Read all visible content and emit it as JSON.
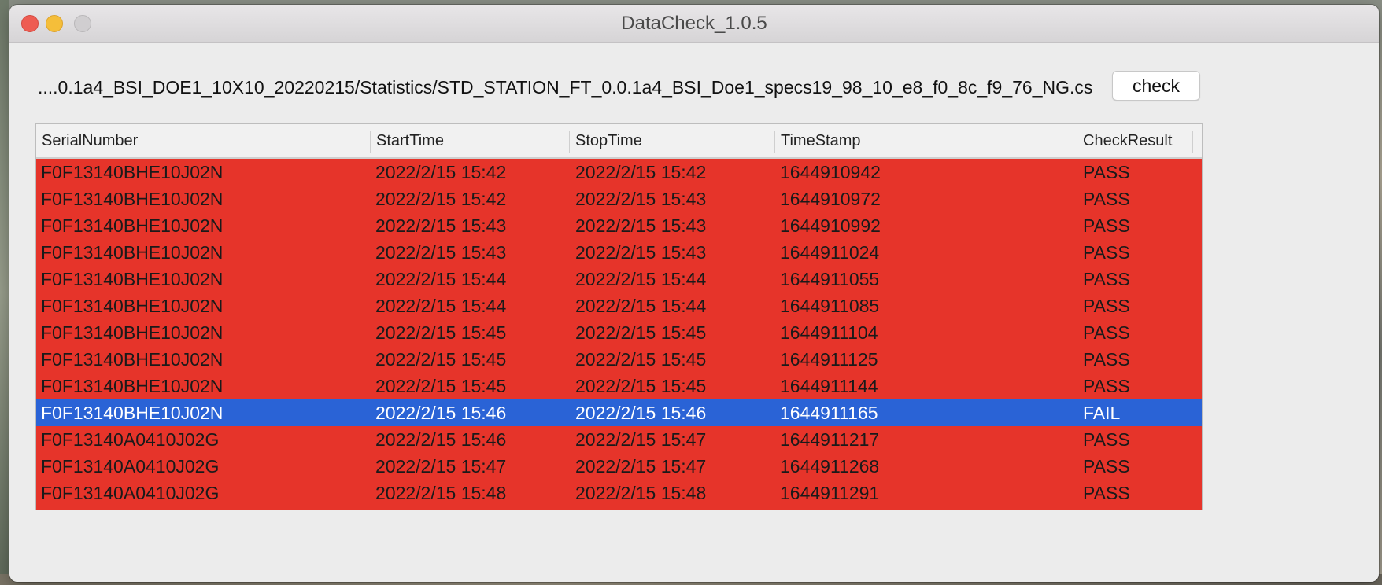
{
  "window": {
    "title": "DataCheck_1.0.5"
  },
  "toolbar": {
    "file_path": "....0.1a4_BSI_DOE1_10X10_20220215/Statistics/STD_STATION_FT_0.0.1a4_BSI_Doe1_specs19_98_10_e8_f0_8c_f9_76_NG.csv",
    "check_label": "check"
  },
  "colors": {
    "row_background": "#e6342a",
    "selected_row_background": "#2a63d6"
  },
  "table": {
    "columns": [
      "SerialNumber",
      "StartTime",
      "StopTime",
      "TimeStamp",
      "CheckResult"
    ],
    "selected_row_index": 9,
    "rows": [
      [
        "F0F13140BHE10J02N",
        "2022/2/15 15:42",
        "2022/2/15 15:42",
        "1644910942",
        "PASS"
      ],
      [
        "F0F13140BHE10J02N",
        "2022/2/15 15:42",
        "2022/2/15 15:43",
        "1644910972",
        "PASS"
      ],
      [
        "F0F13140BHE10J02N",
        "2022/2/15 15:43",
        "2022/2/15 15:43",
        "1644910992",
        "PASS"
      ],
      [
        "F0F13140BHE10J02N",
        "2022/2/15 15:43",
        "2022/2/15 15:43",
        "1644911024",
        "PASS"
      ],
      [
        "F0F13140BHE10J02N",
        "2022/2/15 15:44",
        "2022/2/15 15:44",
        "1644911055",
        "PASS"
      ],
      [
        "F0F13140BHE10J02N",
        "2022/2/15 15:44",
        "2022/2/15 15:44",
        "1644911085",
        "PASS"
      ],
      [
        "F0F13140BHE10J02N",
        "2022/2/15 15:45",
        "2022/2/15 15:45",
        "1644911104",
        "PASS"
      ],
      [
        "F0F13140BHE10J02N",
        "2022/2/15 15:45",
        "2022/2/15 15:45",
        "1644911125",
        "PASS"
      ],
      [
        "F0F13140BHE10J02N",
        "2022/2/15 15:45",
        "2022/2/15 15:45",
        "1644911144",
        "PASS"
      ],
      [
        "F0F13140BHE10J02N",
        "2022/2/15 15:46",
        "2022/2/15 15:46",
        "1644911165",
        "FAIL"
      ],
      [
        "F0F13140A0410J02G",
        "2022/2/15 15:46",
        "2022/2/15 15:47",
        "1644911217",
        "PASS"
      ],
      [
        "F0F13140A0410J02G",
        "2022/2/15 15:47",
        "2022/2/15 15:47",
        "1644911268",
        "PASS"
      ],
      [
        "F0F13140A0410J02G",
        "2022/2/15 15:48",
        "2022/2/15 15:48",
        "1644911291",
        "PASS"
      ]
    ]
  }
}
